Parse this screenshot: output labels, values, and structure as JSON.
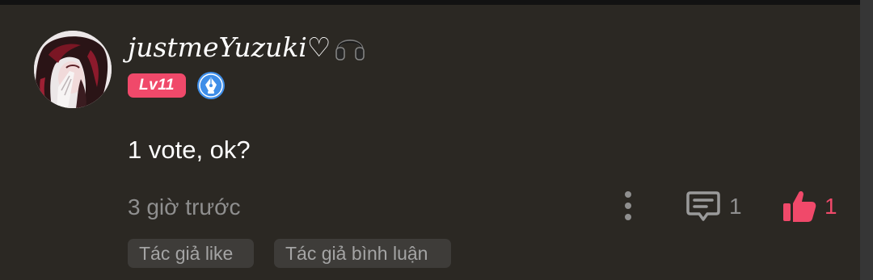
{
  "comment": {
    "username": "justmeYuzuki♡",
    "username_icon": "headphones-icon",
    "level": "Lv11",
    "level_color": "#f0496a",
    "badge_icon": "pen-nib-badge-icon",
    "badge_color": "#3f8ee8",
    "text": "1 vote, ok?",
    "timestamp": "3 giờ trước",
    "actions": {
      "more_icon": "more-vertical-icon",
      "reply_icon": "comment-icon",
      "reply_count": "1",
      "like_icon": "thumbs-up-icon",
      "like_count": "1",
      "like_color": "#f0496a"
    },
    "tags": [
      "Tác giả like",
      "Tác giả bình luận"
    ]
  },
  "colors": {
    "background": "#2b2823",
    "secondary_text": "#8f8f8f",
    "tag_background": "#3e3c39"
  }
}
